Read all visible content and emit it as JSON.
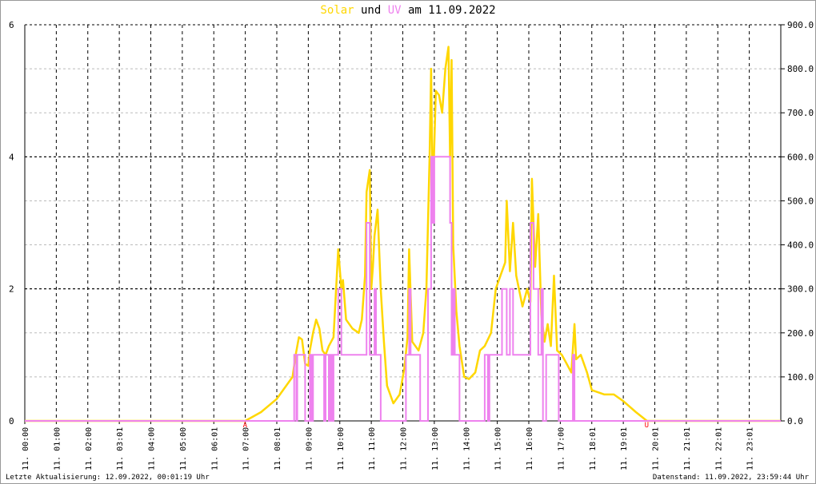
{
  "chart_data": {
    "type": "line",
    "title": {
      "part1": "Solar",
      "part2": " und ",
      "part3": "UV",
      "part4": " am 11.09.2022"
    },
    "colors": {
      "solar": "#FFD700",
      "uv": "#EE82EE",
      "marker": "#FF0000"
    },
    "xlim": [
      0,
      24
    ],
    "x_tick_labels": [
      "11. 00:00",
      "11. 01:00",
      "11. 02:00",
      "11. 03:01",
      "11. 04:00",
      "11. 05:00",
      "11. 06:01",
      "11. 07:00",
      "11. 08:01",
      "11. 09:00",
      "11. 10:00",
      "11. 11:00",
      "11. 12:00",
      "11. 13:00",
      "11. 14:00",
      "11. 15:00",
      "11. 16:00",
      "11. 17:00",
      "11. 18:01",
      "11. 19:01",
      "11. 20:01",
      "11. 21:01",
      "11. 22:01",
      "11. 23:01"
    ],
    "left_axis": {
      "name": "UV",
      "ylim": [
        0,
        6
      ],
      "ticks": [
        "0",
        "2",
        "4",
        "6"
      ]
    },
    "right_axis": {
      "name": "Solar",
      "ylim": [
        0,
        900
      ],
      "ticks": [
        "0.0",
        "100.0",
        "200.0",
        "300.0",
        "400.0",
        "500.0",
        "600.0",
        "700.0",
        "800.0",
        "900.0"
      ]
    },
    "markers": [
      {
        "label": "A",
        "x": 7.0
      },
      {
        "label": "U",
        "x": 19.75
      }
    ],
    "series": [
      {
        "name": "Solar",
        "axis": "right",
        "points": [
          [
            0,
            0
          ],
          [
            7,
            0
          ],
          [
            7.5,
            20
          ],
          [
            8,
            50
          ],
          [
            8.5,
            100
          ],
          [
            8.6,
            150
          ],
          [
            8.7,
            190
          ],
          [
            8.8,
            185
          ],
          [
            8.9,
            130
          ],
          [
            9.0,
            125
          ],
          [
            9.05,
            160
          ],
          [
            9.15,
            200
          ],
          [
            9.25,
            230
          ],
          [
            9.35,
            210
          ],
          [
            9.45,
            160
          ],
          [
            9.55,
            150
          ],
          [
            9.65,
            170
          ],
          [
            9.8,
            190
          ],
          [
            9.95,
            390
          ],
          [
            10.05,
            300
          ],
          [
            10.1,
            320
          ],
          [
            10.2,
            230
          ],
          [
            10.4,
            210
          ],
          [
            10.6,
            200
          ],
          [
            10.7,
            230
          ],
          [
            10.8,
            330
          ],
          [
            10.85,
            520
          ],
          [
            10.95,
            570
          ],
          [
            11.0,
            300
          ],
          [
            11.05,
            350
          ],
          [
            11.1,
            420
          ],
          [
            11.2,
            480
          ],
          [
            11.3,
            300
          ],
          [
            11.4,
            180
          ],
          [
            11.5,
            80
          ],
          [
            11.7,
            40
          ],
          [
            11.9,
            60
          ],
          [
            12.05,
            120
          ],
          [
            12.15,
            190
          ],
          [
            12.2,
            390
          ],
          [
            12.3,
            180
          ],
          [
            12.5,
            160
          ],
          [
            12.65,
            200
          ],
          [
            12.75,
            300
          ],
          [
            12.85,
            600
          ],
          [
            12.9,
            800
          ],
          [
            12.95,
            500
          ],
          [
            13.05,
            750
          ],
          [
            13.15,
            740
          ],
          [
            13.25,
            700
          ],
          [
            13.35,
            800
          ],
          [
            13.45,
            850
          ],
          [
            13.5,
            600
          ],
          [
            13.55,
            820
          ],
          [
            13.6,
            400
          ],
          [
            13.7,
            250
          ],
          [
            13.8,
            170
          ],
          [
            13.95,
            100
          ],
          [
            14.1,
            95
          ],
          [
            14.3,
            110
          ],
          [
            14.45,
            160
          ],
          [
            14.6,
            170
          ],
          [
            14.8,
            200
          ],
          [
            14.95,
            300
          ],
          [
            15.1,
            330
          ],
          [
            15.25,
            360
          ],
          [
            15.3,
            500
          ],
          [
            15.4,
            340
          ],
          [
            15.5,
            450
          ],
          [
            15.6,
            330
          ],
          [
            15.8,
            260
          ],
          [
            15.95,
            300
          ],
          [
            16.05,
            270
          ],
          [
            16.1,
            550
          ],
          [
            16.2,
            350
          ],
          [
            16.3,
            470
          ],
          [
            16.4,
            240
          ],
          [
            16.5,
            180
          ],
          [
            16.6,
            220
          ],
          [
            16.7,
            170
          ],
          [
            16.8,
            330
          ],
          [
            16.9,
            160
          ],
          [
            17.05,
            150
          ],
          [
            17.2,
            130
          ],
          [
            17.35,
            110
          ],
          [
            17.45,
            220
          ],
          [
            17.5,
            140
          ],
          [
            17.65,
            150
          ],
          [
            17.85,
            110
          ],
          [
            18.0,
            70
          ],
          [
            18.4,
            60
          ],
          [
            18.7,
            60
          ],
          [
            19.0,
            45
          ],
          [
            19.4,
            20
          ],
          [
            19.75,
            0
          ],
          [
            24,
            0
          ]
        ]
      },
      {
        "name": "UV",
        "axis": "left",
        "steps": [
          [
            0,
            0
          ],
          [
            8.55,
            1
          ],
          [
            8.62,
            0
          ],
          [
            8.65,
            1
          ],
          [
            8.9,
            0
          ],
          [
            9.05,
            1
          ],
          [
            9.1,
            0
          ],
          [
            9.15,
            1
          ],
          [
            9.5,
            0
          ],
          [
            9.55,
            1
          ],
          [
            9.65,
            0
          ],
          [
            9.7,
            1
          ],
          [
            9.75,
            0
          ],
          [
            9.8,
            1
          ],
          [
            9.95,
            2
          ],
          [
            10.05,
            1
          ],
          [
            10.85,
            3
          ],
          [
            10.95,
            1
          ],
          [
            11.1,
            2
          ],
          [
            11.15,
            1
          ],
          [
            11.3,
            0
          ],
          [
            12.1,
            1
          ],
          [
            12.2,
            2
          ],
          [
            12.25,
            1
          ],
          [
            12.55,
            0
          ],
          [
            12.8,
            2
          ],
          [
            12.9,
            4
          ],
          [
            12.95,
            3
          ],
          [
            13.0,
            4
          ],
          [
            13.5,
            3
          ],
          [
            13.55,
            1
          ],
          [
            13.6,
            2
          ],
          [
            13.65,
            1
          ],
          [
            13.8,
            0
          ],
          [
            14.6,
            1
          ],
          [
            14.7,
            0
          ],
          [
            14.75,
            1
          ],
          [
            15.15,
            2
          ],
          [
            15.3,
            1
          ],
          [
            15.4,
            2
          ],
          [
            15.5,
            1
          ],
          [
            16.05,
            3
          ],
          [
            16.15,
            2
          ],
          [
            16.3,
            1
          ],
          [
            16.4,
            2
          ],
          [
            16.45,
            0
          ],
          [
            16.55,
            1
          ],
          [
            16.95,
            0
          ],
          [
            17.4,
            1
          ],
          [
            17.45,
            0
          ],
          [
            24,
            0
          ]
        ]
      }
    ]
  },
  "footer": {
    "left": "Letzte Aktualisierung: 12.09.2022, 00:01:19 Uhr",
    "right": "Datenstand: 11.09.2022, 23:59:44 Uhr"
  }
}
